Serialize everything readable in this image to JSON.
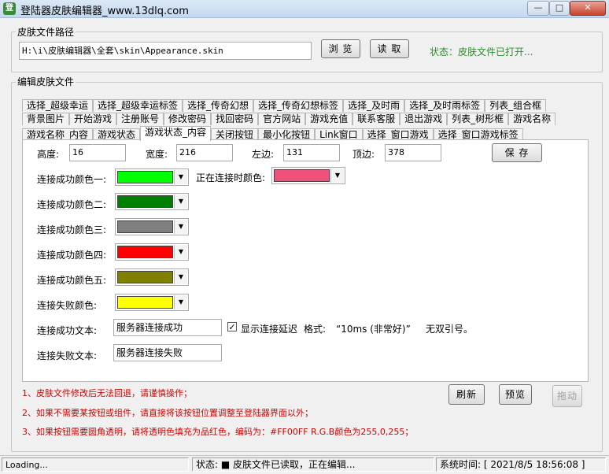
{
  "window": {
    "title": "登陆器皮肤编辑器_www.13dlq.com",
    "icon_text": "登",
    "minimize": "—",
    "maximize": "□",
    "close": "✕"
  },
  "path_group": {
    "legend": "皮肤文件路径",
    "path_value": "H:\\i\\皮肤编辑器\\全套\\skin\\Appearance.skin",
    "browse_label": "浏 览",
    "read_label": "读 取",
    "status_text": "状态：皮肤文件已打开..."
  },
  "edit_group": {
    "legend": "编辑皮肤文件"
  },
  "tabs": {
    "row1": [
      "选择_超级幸运",
      "选择_超级幸运标签",
      "选择_传奇幻想",
      "选择_传奇幻想标签",
      "选择_及时雨",
      "选择_及时雨标签",
      "列表_组合框"
    ],
    "row2": [
      "背景图片",
      "开始游戏",
      "注册账号",
      "修改密码",
      "找回密码",
      "官方网站",
      "游戏充值",
      "联系客服",
      "退出游戏",
      "列表_树形框",
      "游戏名称"
    ],
    "row3": [
      "游戏名称_内容",
      "游戏状态",
      "游戏状态_内容",
      "关闭按钮",
      "最小化按钮",
      "Link窗口",
      "选择_窗口游戏",
      "选择_窗口游戏标签"
    ]
  },
  "form": {
    "height_label": "高度:",
    "height_value": "16",
    "width_label": "宽度:",
    "width_value": "216",
    "left_label": "左边:",
    "left_value": "131",
    "top_label": "顶边:",
    "top_value": "378",
    "save_label": "保 存",
    "color1_label": "连接成功颜色一:",
    "color1": "#00ff00",
    "connecting_label": "正在连接时颜色:",
    "connecting_color": "#f0507a",
    "color2_label": "连接成功颜色二:",
    "color2": "#008000",
    "color3_label": "连接成功颜色三:",
    "color3": "#808080",
    "color4_label": "连接成功颜色四:",
    "color4": "#ff0000",
    "color5_label": "连接成功颜色五:",
    "color5": "#808000",
    "fail_color_label": "连接失败颜色:",
    "fail_color": "#ffff00",
    "success_text_label": "连接成功文本:",
    "success_text_value": "服务器连接成功",
    "delay_check_mark": "✓",
    "delay_label": "显示连接延迟",
    "format_label": "格式:",
    "format_value": "“10ms (非常好)”",
    "no_quote_label": "无双引号。",
    "fail_text_label": "连接失败文本:",
    "fail_text_value": "服务器连接失败"
  },
  "notes": [
    "1、皮肤文件修改后无法回退，请谨慎操作；",
    "2、如果不需要某按钮或组件，请直接将该按钮位置调整至登陆器界面以外；",
    "3、如果按钮需要圆角透明，请将透明色填充为品红色，编码为：#FF00FF R.G.B颜色为255,0,255；"
  ],
  "actions": {
    "refresh_label": "刷新",
    "preview_label": "预览",
    "drag_label": "拖动"
  },
  "statusbar": {
    "left": "Loading...",
    "middle": "状态: ■ 皮肤文件已读取，正在编辑...",
    "right": "系统时间: [ 2021/8/5 18:56:08 ]"
  }
}
